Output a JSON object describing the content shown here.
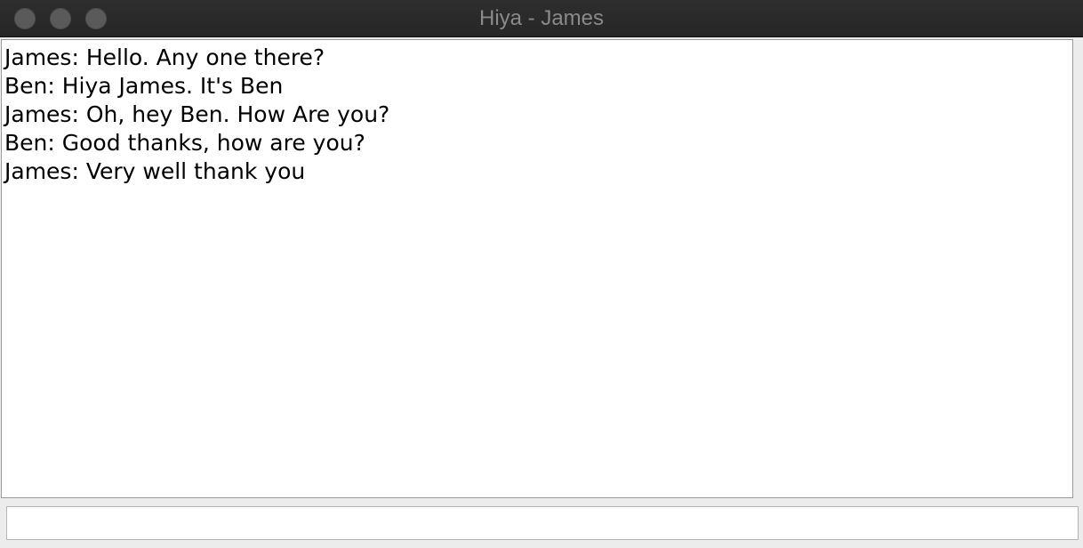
{
  "window": {
    "title": "Hiya - James"
  },
  "chat": {
    "messages": [
      "James: Hello. Any one there?",
      "Ben: Hiya James. It's Ben",
      "James: Oh, hey Ben. How Are you?",
      "Ben: Good thanks, how are you?",
      "James: Very well thank you"
    ]
  },
  "input": {
    "value": "",
    "placeholder": ""
  }
}
